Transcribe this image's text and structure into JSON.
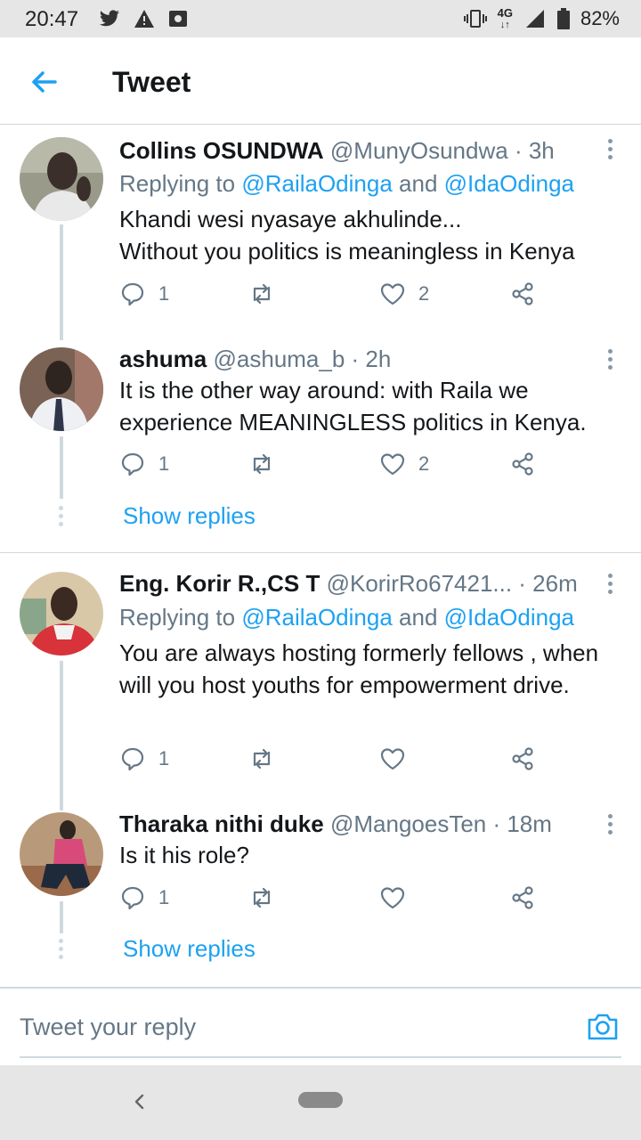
{
  "status_bar": {
    "time": "20:47",
    "network": "4G",
    "battery": "82%",
    "icons_left": [
      "twitter-icon",
      "warning-icon",
      "camera-notification-icon"
    ],
    "icons_right": [
      "vibrate-icon",
      "network-4g-icon",
      "signal-icon",
      "battery-icon"
    ]
  },
  "header": {
    "title": "Tweet",
    "back_icon": "arrow-left-icon"
  },
  "tweets": [
    {
      "name": "Collins OSUNDWA",
      "meta": "@MunyOsundwa · 3h",
      "replying_prefix": "Replying to ",
      "replying_user1": "@RailaOdinga",
      "replying_and": " and ",
      "replying_user2": "@IdaOdinga",
      "body": "Khandi wesi nyasaye akhulinde...\nWithout you politics is meaningless in Kenya",
      "replies": "1",
      "retweets": "",
      "likes": "2"
    },
    {
      "name": "ashuma",
      "meta": "@ashuma_b · 2h",
      "body": "It is the other way around: with Raila we experience MEANINGLESS politics in Kenya.",
      "replies": "1",
      "retweets": "",
      "likes": "2",
      "show_replies": "Show replies"
    },
    {
      "name": "Eng. Korir R.,CS T",
      "meta": "@KorirRo67421... · 26m",
      "replying_prefix": "Replying to ",
      "replying_user1": "@RailaOdinga",
      "replying_and": " and ",
      "replying_user2": "@IdaOdinga",
      "body": "You are always hosting formerly fellows , when will you host youths for empowerment drive.",
      "replies": "1",
      "retweets": "",
      "likes": ""
    },
    {
      "name": "Tharaka nithi duke",
      "meta": "@MangoesTen · 18m",
      "body": "Is it his role?",
      "replies": "1",
      "retweets": "",
      "likes": "",
      "show_replies": "Show replies"
    }
  ],
  "reply_bar": {
    "placeholder": "Tweet your reply",
    "camera_icon": "camera-icon"
  },
  "nav_bar": {
    "back_icon": "chevron-left-icon",
    "home_icon": "home-pill-icon"
  },
  "colors": {
    "accent": "#1da1f2",
    "text": "#14171a",
    "secondary": "#657786",
    "divider": "#cfd9de"
  }
}
